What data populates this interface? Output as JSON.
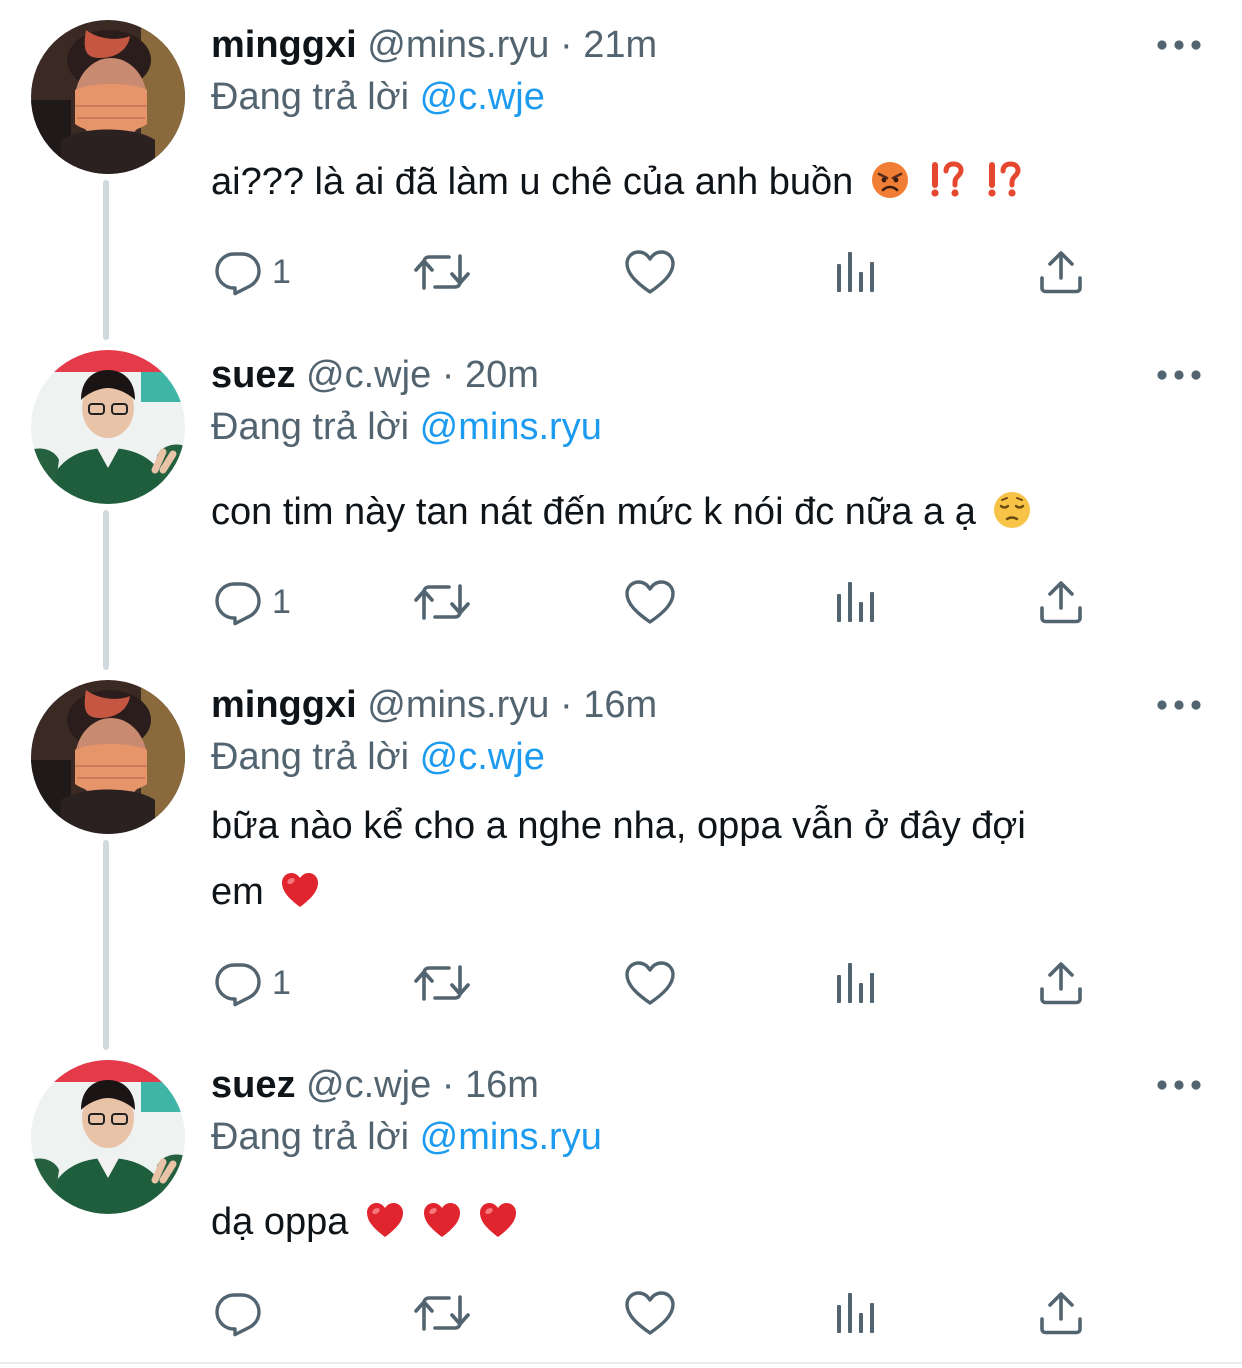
{
  "colors": {
    "accent": "#1d9bf0",
    "secondary_text": "#536471",
    "primary_text": "#0f1419",
    "thread_line": "#cfd9de"
  },
  "thread": [
    {
      "name": "minggxi",
      "handle": "@mins.ryu",
      "separator": "·",
      "time": "21m",
      "reply_label": "Đang trả lời",
      "reply_mention": "@c.wje",
      "text": "ai??? là ai đã làm u chê của anh buồn",
      "emojis": [
        "angry-face-emoji",
        "interrobang-emoji",
        "interrobang-emoji"
      ],
      "reply_count": "1",
      "avatar": "avatar-minggxi"
    },
    {
      "name": "suez",
      "handle": "@c.wje",
      "separator": "·",
      "time": "20m",
      "reply_label": "Đang trả lời",
      "reply_mention": "@mins.ryu",
      "text": "con tim này tan nát đến mức k nói đc nữa a ạ",
      "emojis": [
        "pensive-face-emoji"
      ],
      "reply_count": "1",
      "avatar": "avatar-suez"
    },
    {
      "name": "minggxi",
      "handle": "@mins.ryu",
      "separator": "·",
      "time": "16m",
      "reply_label": "Đang trả lời",
      "reply_mention": "@c.wje",
      "text_line1": "bữa nào kể cho a nghe nha, oppa vẫn ở đây đợi",
      "text_line2": "em",
      "emojis": [
        "red-heart-emoji"
      ],
      "reply_count": "1",
      "avatar": "avatar-minggxi"
    },
    {
      "name": "suez",
      "handle": "@c.wje",
      "separator": "·",
      "time": "16m",
      "reply_label": "Đang trả lời",
      "reply_mention": "@mins.ryu",
      "text": "dạ oppa",
      "emojis": [
        "red-heart-emoji",
        "red-heart-emoji",
        "red-heart-emoji"
      ],
      "reply_count": "",
      "avatar": "avatar-suez"
    }
  ],
  "action_icons": [
    "reply-icon",
    "retweet-icon",
    "like-icon",
    "views-icon",
    "share-icon"
  ]
}
